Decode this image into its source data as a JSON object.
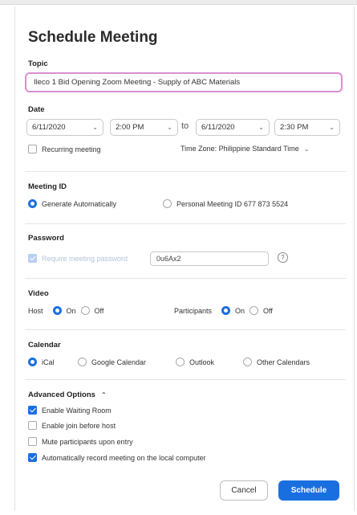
{
  "dialog": {
    "title": "Schedule Meeting",
    "topic": {
      "label": "Topic",
      "value": "Ileco 1 Bid Opening Zoom Meeting - Supply of ABC Materials"
    },
    "date": {
      "label": "Date",
      "start_date": "6/11/2020",
      "start_time": "2:00 PM",
      "separator": "to",
      "end_date": "6/11/2020",
      "end_time": "2:30 PM",
      "recurring_label": "Recurring meeting",
      "recurring_checked": false,
      "timezone": "Time Zone: Philippine Standard Time"
    },
    "meeting_id": {
      "label": "Meeting ID",
      "option_auto": "Generate Automatically",
      "option_personal": "Personal Meeting ID 677 873 5524",
      "selected": "auto"
    },
    "password": {
      "label": "Password",
      "require_label": "Require meeting password",
      "require_checked": true,
      "value": "0u6Ax2"
    },
    "video": {
      "label": "Video",
      "host_label": "Host",
      "participants_label": "Participants",
      "on": "On",
      "off": "Off",
      "host": "on",
      "participants": "on"
    },
    "calendar": {
      "label": "Calendar",
      "options": [
        "iCal",
        "Google Calendar",
        "Outlook",
        "Other Calendars"
      ],
      "selected": "iCal"
    },
    "advanced": {
      "label": "Advanced Options",
      "options": [
        {
          "label": "Enable Waiting Room",
          "checked": true
        },
        {
          "label": "Enable join before host",
          "checked": false
        },
        {
          "label": "Mute participants upon entry",
          "checked": false
        },
        {
          "label": "Automatically record meeting on the local computer",
          "checked": true
        }
      ]
    },
    "buttons": {
      "cancel": "Cancel",
      "schedule": "Schedule"
    }
  },
  "colors": {
    "accent": "#1a6fe0",
    "topic_focus_border": "#d98fd0"
  }
}
